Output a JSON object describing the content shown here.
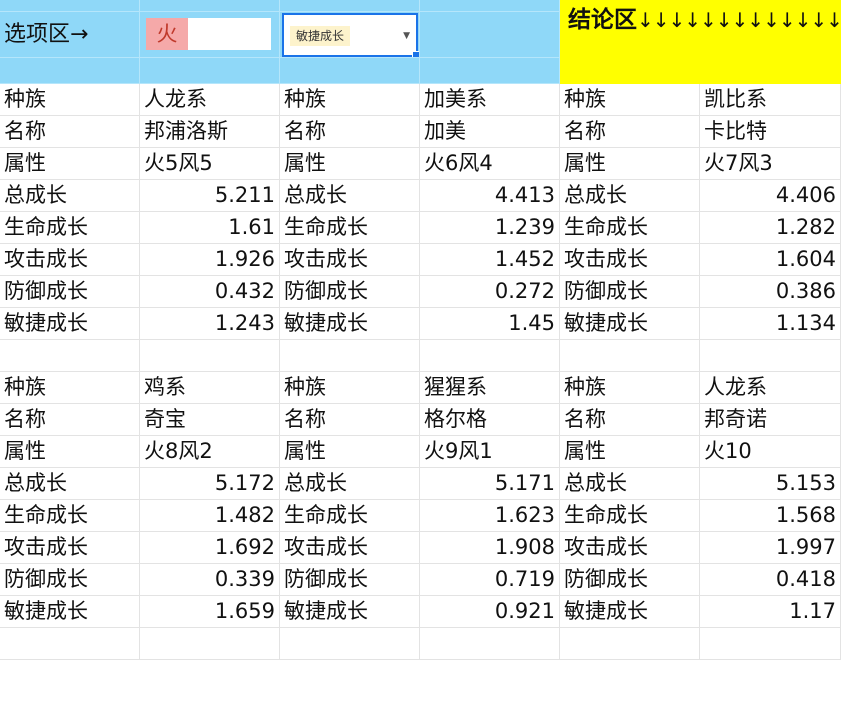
{
  "header": {
    "options_label": "选项区→",
    "element_value": "火",
    "dropdown_value": "敏捷成长",
    "conclusion_label": "结论区",
    "conclusion_arrows": "↓↓↓↓↓↓↓↓↓↓↓↓↓"
  },
  "colors": {
    "options_band": "#8fd8f8",
    "conclusion_band": "#ffff00",
    "element_pill": "#f5a9a9",
    "dropdown_tag": "#fdf3cc",
    "selection_border": "#1a73e8"
  },
  "row_labels": [
    "种族",
    "名称",
    "属性",
    "总成长",
    "生命成长",
    "攻击成长",
    "防御成长",
    "敏捷成长"
  ],
  "blocks": [
    {
      "race": "人龙系",
      "name": "邦浦洛斯",
      "attr": "火5风5",
      "total": "5.211",
      "hp": "1.61",
      "atk": "1.926",
      "def": "0.432",
      "agi": "1.243"
    },
    {
      "race": "加美系",
      "name": "加美",
      "attr": "火6风4",
      "total": "4.413",
      "hp": "1.239",
      "atk": "1.452",
      "def": "0.272",
      "agi": "1.45"
    },
    {
      "race": "凯比系",
      "name": "卡比特",
      "attr": "火7风3",
      "total": "4.406",
      "hp": "1.282",
      "atk": "1.604",
      "def": "0.386",
      "agi": "1.134"
    },
    {
      "race": "鸡系",
      "name": "奇宝",
      "attr": "火8风2",
      "total": "5.172",
      "hp": "1.482",
      "atk": "1.692",
      "def": "0.339",
      "agi": "1.659"
    },
    {
      "race": "猩猩系",
      "name": "格尔格",
      "attr": "火9风1",
      "total": "5.171",
      "hp": "1.623",
      "atk": "1.908",
      "def": "0.719",
      "agi": "0.921"
    },
    {
      "race": "人龙系",
      "name": "邦奇诺",
      "attr": "火10",
      "total": "5.153",
      "hp": "1.568",
      "atk": "1.997",
      "def": "0.418",
      "agi": "1.17"
    }
  ]
}
